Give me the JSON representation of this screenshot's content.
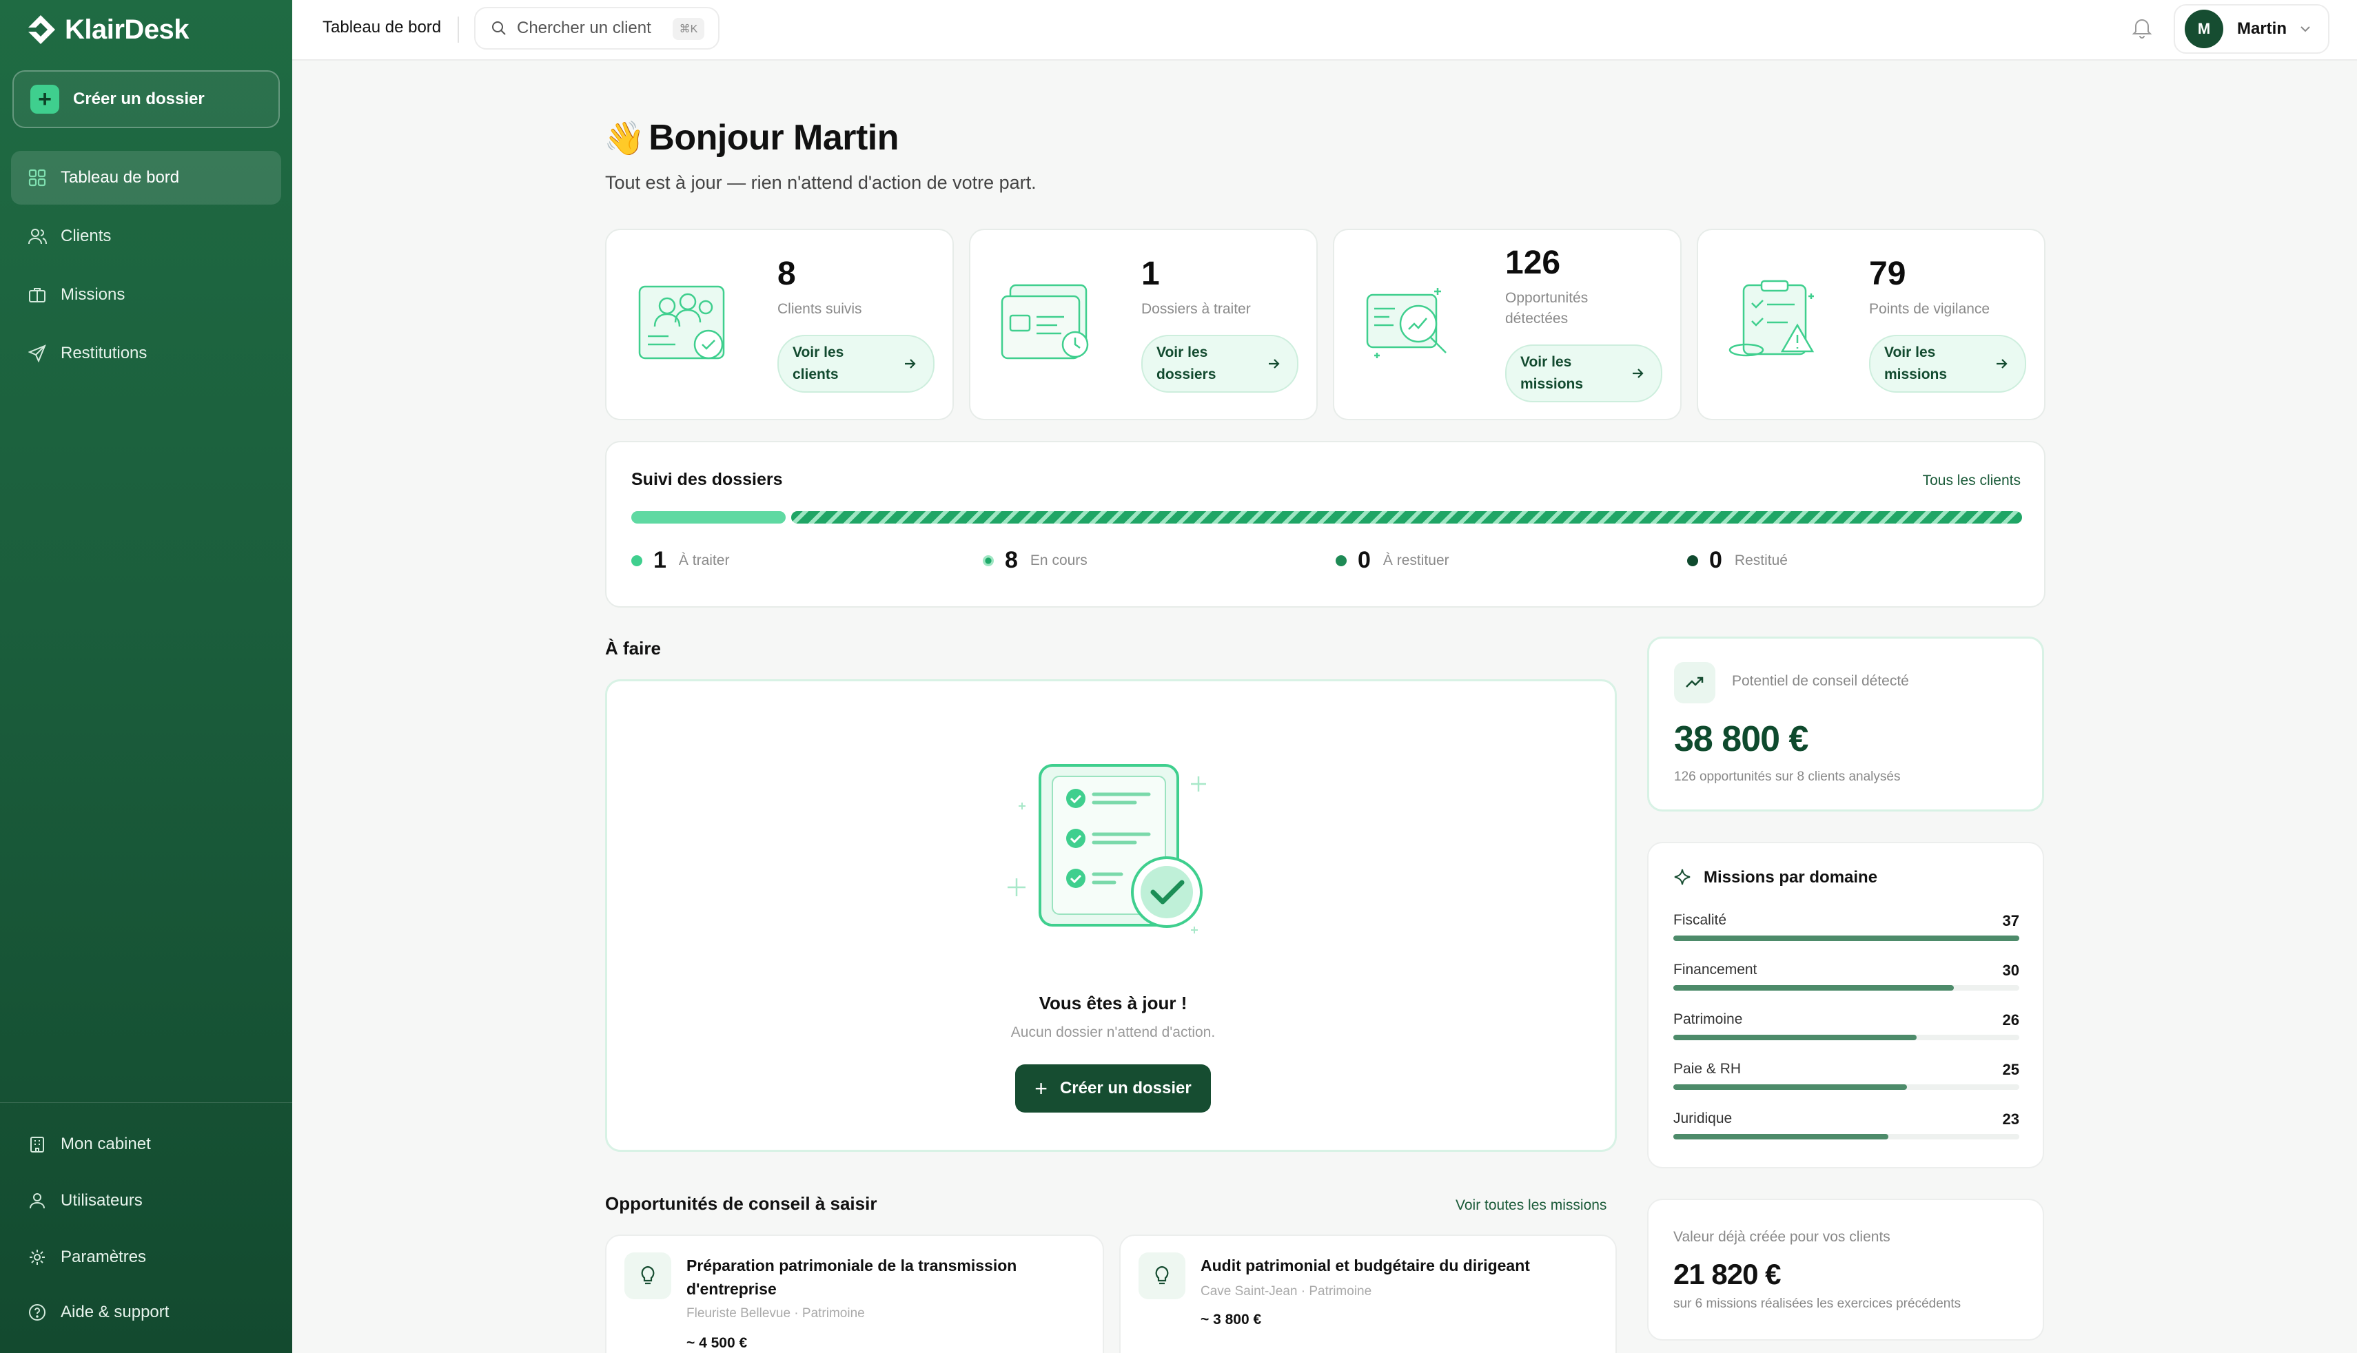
{
  "app": {
    "name": "KlairDesk"
  },
  "sidebar": {
    "create_label": "Créer un dossier",
    "items": [
      {
        "label": "Tableau de bord",
        "icon": "grid-icon",
        "active": true
      },
      {
        "label": "Clients",
        "icon": "users-icon"
      },
      {
        "label": "Missions",
        "icon": "briefcase-icon"
      },
      {
        "label": "Restitutions",
        "icon": "send-icon"
      }
    ],
    "bottom_items": [
      {
        "label": "Mon cabinet",
        "icon": "building-icon"
      },
      {
        "label": "Utilisateurs",
        "icon": "user-icon"
      },
      {
        "label": "Paramètres",
        "icon": "gear-icon"
      },
      {
        "label": "Aide & support",
        "icon": "help-icon"
      }
    ]
  },
  "topbar": {
    "breadcrumb": "Tableau de bord",
    "search_placeholder": "Chercher un client",
    "search_shortcut": "⌘K",
    "user_initial": "M",
    "user_name": "Martin"
  },
  "greeting": {
    "emoji": "👋",
    "title": "Bonjour Martin",
    "subtitle": "Tout est à jour — rien n'attend d'action de votre part."
  },
  "stats": [
    {
      "value": "8",
      "label": "Clients suivis",
      "button": "Voir les clients"
    },
    {
      "value": "1",
      "label": "Dossiers à traiter",
      "button": "Voir les dossiers"
    },
    {
      "value": "126",
      "label": "Opportunités détectées",
      "button": "Voir les missions"
    },
    {
      "value": "79",
      "label": "Points de vigilance",
      "button": "Voir les missions"
    }
  ],
  "suivi": {
    "title": "Suivi des dossiers",
    "link": "Tous les clients",
    "statuses": [
      {
        "count": "1",
        "label": "À traiter",
        "color": "#3fcf8e"
      },
      {
        "count": "8",
        "label": "En cours",
        "color": "#1faa6a"
      },
      {
        "count": "0",
        "label": "À restituer",
        "color": "#1e8a55"
      },
      {
        "count": "0",
        "label": "Restitué",
        "color": "#0f4a2e"
      }
    ]
  },
  "todo": {
    "section_title": "À faire",
    "title": "Vous êtes à jour !",
    "subtitle": "Aucun dossier n'attend d'action.",
    "button": "Créer un dossier"
  },
  "potentiel": {
    "label": "Potentiel de conseil détecté",
    "value": "38 800 €",
    "sub": "126 opportunités sur 8 clients analysés"
  },
  "domaines": {
    "title": "Missions par domaine",
    "max": 37,
    "items": [
      {
        "name": "Fiscalité",
        "value": 37
      },
      {
        "name": "Financement",
        "value": 30
      },
      {
        "name": "Patrimoine",
        "value": 26
      },
      {
        "name": "Paie & RH",
        "value": 25
      },
      {
        "name": "Juridique",
        "value": 23
      }
    ]
  },
  "valeur": {
    "label": "Valeur déjà créée pour vos clients",
    "value": "21 820 €",
    "sub": "sur 6 missions réalisées les exercices précédents"
  },
  "opportunites": {
    "title": "Opportunités de conseil à saisir",
    "link": "Voir toutes les missions",
    "items": [
      {
        "title": "Préparation patrimoniale de la transmission d'entreprise",
        "meta": "Fleuriste Bellevue · Patrimoine",
        "amount": "~ 4 500 €"
      },
      {
        "title": "Audit patrimonial et budgétaire du dirigeant",
        "meta": "Cave Saint-Jean · Patrimoine",
        "amount": "~ 3 800 €"
      }
    ]
  },
  "colors": {
    "brand": "#1b5e3c",
    "accent": "#3fcf8e",
    "dark_button": "#164d31",
    "bar": "#4d8b6a"
  }
}
